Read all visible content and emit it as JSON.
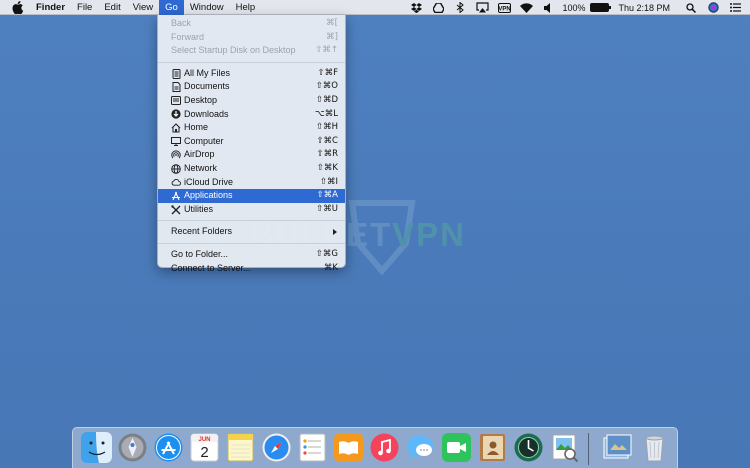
{
  "menubar": {
    "app_name": "Finder",
    "menus": [
      "File",
      "Edit",
      "View",
      "Go",
      "Window",
      "Help"
    ],
    "active_menu": "Go",
    "status": {
      "battery_percent": "100%",
      "clock": "Thu 2:18 PM",
      "icons": [
        "dropbox-icon",
        "drive-icon",
        "bluetooth-icon",
        "airplay-icon",
        "vpn-icon",
        "wifi-icon",
        "volume-icon",
        "battery-icon",
        "search-icon",
        "siri-icon",
        "notification-list-icon"
      ]
    }
  },
  "go_menu": {
    "nav": [
      {
        "label": "Back",
        "shortcut": "⌘[",
        "enabled": false
      },
      {
        "label": "Forward",
        "shortcut": "⌘]",
        "enabled": false
      },
      {
        "label": "Select Startup Disk on Desktop",
        "shortcut": "⇧⌘↑",
        "enabled": false
      }
    ],
    "places": [
      {
        "label": "All My Files",
        "shortcut": "⇧⌘F",
        "icon": "all-files-icon"
      },
      {
        "label": "Documents",
        "shortcut": "⇧⌘O",
        "icon": "documents-icon"
      },
      {
        "label": "Desktop",
        "shortcut": "⇧⌘D",
        "icon": "desktop-icon"
      },
      {
        "label": "Downloads",
        "shortcut": "⌥⌘L",
        "icon": "downloads-icon"
      },
      {
        "label": "Home",
        "shortcut": "⇧⌘H",
        "icon": "home-icon"
      },
      {
        "label": "Computer",
        "shortcut": "⇧⌘C",
        "icon": "computer-icon"
      },
      {
        "label": "AirDrop",
        "shortcut": "⇧⌘R",
        "icon": "airdrop-icon"
      },
      {
        "label": "Network",
        "shortcut": "⇧⌘K",
        "icon": "network-icon"
      },
      {
        "label": "iCloud Drive",
        "shortcut": "⇧⌘I",
        "icon": "icloud-icon"
      },
      {
        "label": "Applications",
        "shortcut": "⇧⌘A",
        "icon": "applications-icon",
        "selected": true
      },
      {
        "label": "Utilities",
        "shortcut": "⇧⌘U",
        "icon": "utilities-icon"
      }
    ],
    "recent_folders": "Recent Folders",
    "go_to_folder": {
      "label": "Go to Folder...",
      "shortcut": "⇧⌘G"
    },
    "connect_to_server": {
      "label": "Connect to Server...",
      "shortcut": "⌘K"
    }
  },
  "watermark": {
    "text_a": "BULLET",
    "text_b": "VPN"
  },
  "dock": {
    "calendar_month": "JUN",
    "calendar_day": "2",
    "apps": [
      "finder-icon",
      "launchpad-icon",
      "app-store-icon",
      "calendar-icon",
      "notes-icon",
      "safari-icon",
      "reminders-icon",
      "ibooks-icon",
      "itunes-icon",
      "messages-icon",
      "facetime-icon",
      "contacts-icon",
      "time-machine-icon",
      "preview-icon",
      "downloads-stack-icon",
      "trash-icon"
    ]
  },
  "colors": {
    "accent": "#2f69d2",
    "desktop": "#4a7ab9",
    "menubar": "#e3e6ec"
  }
}
